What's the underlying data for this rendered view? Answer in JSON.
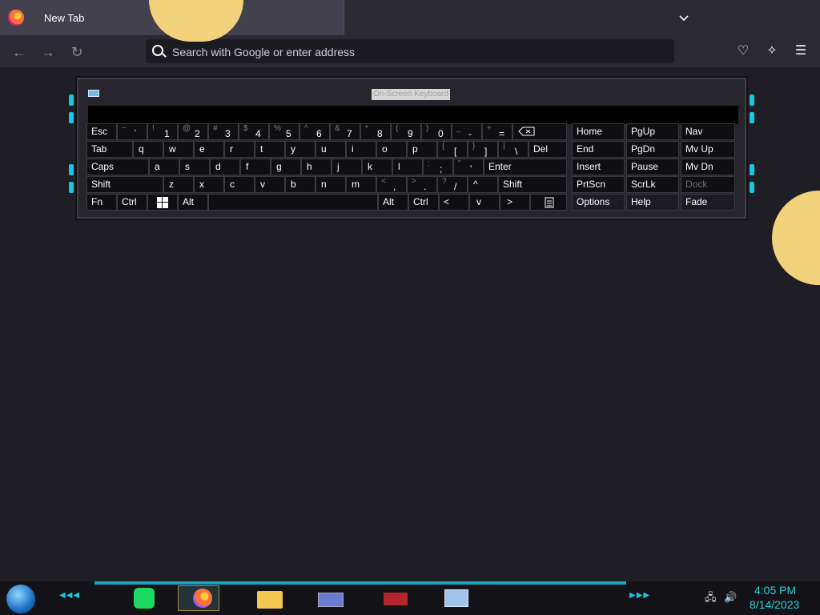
{
  "browser": {
    "tab_title": "New Tab",
    "address_placeholder": "Search with Google or enter address"
  },
  "osk": {
    "title": "On-Screen Keyboard",
    "keys": {
      "esc": "Esc",
      "tilde_sh": "~",
      "tilde": "`",
      "k1_sh": "!",
      "k1": "1",
      "k2_sh": "@",
      "k2": "2",
      "k3_sh": "#",
      "k3": "3",
      "k4_sh": "$",
      "k4": "4",
      "k5_sh": "%",
      "k5": "5",
      "k6_sh": "^",
      "k6": "6",
      "k7_sh": "&",
      "k7": "7",
      "k8_sh": "*",
      "k8": "8",
      "k9_sh": "(",
      "k9": "9",
      "k0_sh": ")",
      "k0": "0",
      "minus_sh": "_",
      "minus": "-",
      "eq_sh": "+",
      "eq": "=",
      "tab": "Tab",
      "q": "q",
      "w": "w",
      "e": "e",
      "r": "r",
      "t": "t",
      "y": "y",
      "u": "u",
      "i": "i",
      "o": "o",
      "p": "p",
      "lb_sh": "{",
      "lb": "[",
      "rb_sh": "}",
      "rb": "]",
      "bs_sh": "|",
      "bs": "\\",
      "del": "Del",
      "caps": "Caps",
      "a": "a",
      "s": "s",
      "d": "d",
      "f": "f",
      "g": "g",
      "h": "h",
      "j": "j",
      "k": "k",
      "l": "l",
      "semi_sh": ":",
      "semi": ";",
      "quote_sh": "\"",
      "quote": "'",
      "enter": "Enter",
      "shift": "Shift",
      "z": "z",
      "x": "x",
      "c": "c",
      "v": "v",
      "b": "b",
      "n": "n",
      "m": "m",
      "comma_sh": "<",
      "comma": ",",
      "dot_sh": ">",
      "dot": ".",
      "slash_sh": "?",
      "slash": "/",
      "up": "^",
      "shift_r": "Shift",
      "fn": "Fn",
      "ctrl": "Ctrl",
      "alt": "Alt",
      "alt_r": "Alt",
      "ctrl_r": "Ctrl",
      "left": "<",
      "down": "v",
      "right": ">",
      "home": "Home",
      "pgup": "PgUp",
      "nav": "Nav",
      "end": "End",
      "pgdn": "PgDn",
      "mvup": "Mv Up",
      "insert": "Insert",
      "pause": "Pause",
      "mvdn": "Mv Dn",
      "prtscn": "PrtScn",
      "scrlk": "ScrLk",
      "dock": "Dock",
      "options": "Options",
      "help": "Help",
      "fade": "Fade"
    }
  },
  "taskbar": {
    "time": "4:05 PM",
    "date": "8/14/2023"
  }
}
